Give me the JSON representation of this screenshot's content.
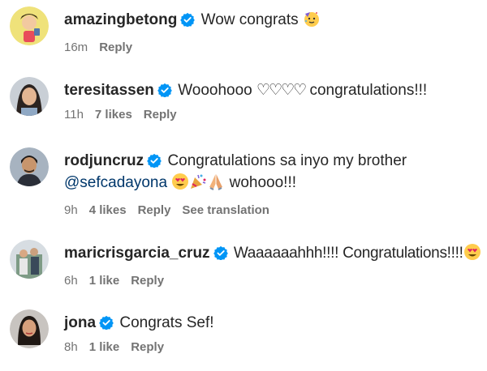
{
  "comments": [
    {
      "username": "amazingbetong",
      "text": "Wow congrats",
      "emojis": [
        "partying-face"
      ],
      "time": "16m",
      "likes": "",
      "reply": "Reply",
      "translate": ""
    },
    {
      "username": "teresitassen",
      "text_before": "Wooohooo ",
      "hearts": "♡♡♡♡",
      "text_after": " congratulations!!!",
      "time": "11h",
      "likes": "7 likes",
      "reply": "Reply",
      "translate": ""
    },
    {
      "username": "rodjuncruz",
      "text": "Congratulations sa inyo my brother",
      "mention": "@sefcadayona",
      "emojis": [
        "heart-eyes-face",
        "party-popper",
        "folded-hands"
      ],
      "text_after": "wohooo!!!",
      "time": "9h",
      "likes": "4 likes",
      "reply": "Reply",
      "translate": "See translation"
    },
    {
      "username": "maricrisgarcia_cruz",
      "text": "Waaaaaahhh!!!! Congratulations!!!!",
      "emojis": [
        "heart-eyes-face"
      ],
      "time": "6h",
      "likes": "1 like",
      "reply": "Reply",
      "translate": ""
    },
    {
      "username": "jona",
      "text": "Congrats Sef!",
      "time": "8h",
      "likes": "1 like",
      "reply": "Reply",
      "translate": ""
    }
  ],
  "colors": {
    "verified_blue": "#0095f6",
    "meta_gray": "#737373",
    "mention_blue": "#00376b"
  }
}
